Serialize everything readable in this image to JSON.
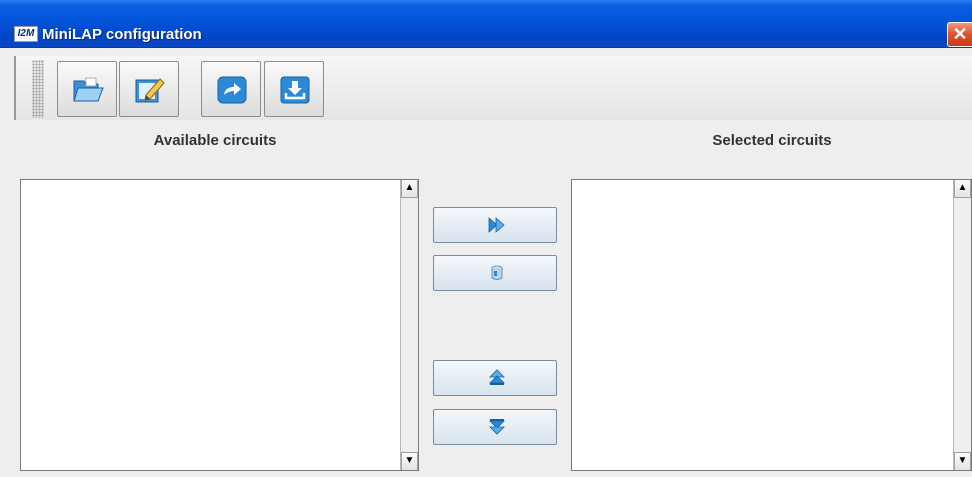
{
  "window": {
    "logo_text": "I2M",
    "title": "MiniLAP configuration",
    "close_glyph": "✕"
  },
  "toolbar": {
    "buttons": [
      {
        "name": "open-folder",
        "icon": "open-folder-icon"
      },
      {
        "name": "edit",
        "icon": "edit-pencil-icon"
      },
      {
        "name": "export",
        "icon": "export-arrow-icon"
      },
      {
        "name": "download",
        "icon": "download-icon"
      }
    ]
  },
  "panels": {
    "available_label": "Available circuits",
    "selected_label": "Selected circuits",
    "available_items": [],
    "selected_items": []
  },
  "transfer_buttons": [
    {
      "name": "add-selected",
      "icon": "double-arrow-right-icon"
    },
    {
      "name": "database",
      "icon": "database-icon"
    },
    {
      "name": "move-up",
      "icon": "move-up-icon"
    },
    {
      "name": "move-down",
      "icon": "move-down-icon"
    }
  ],
  "colors": {
    "titlebar": "#0254d8",
    "close": "#e0502c",
    "accent_icon": "#2b8ad8",
    "panel_bg": "#eeeeee"
  }
}
